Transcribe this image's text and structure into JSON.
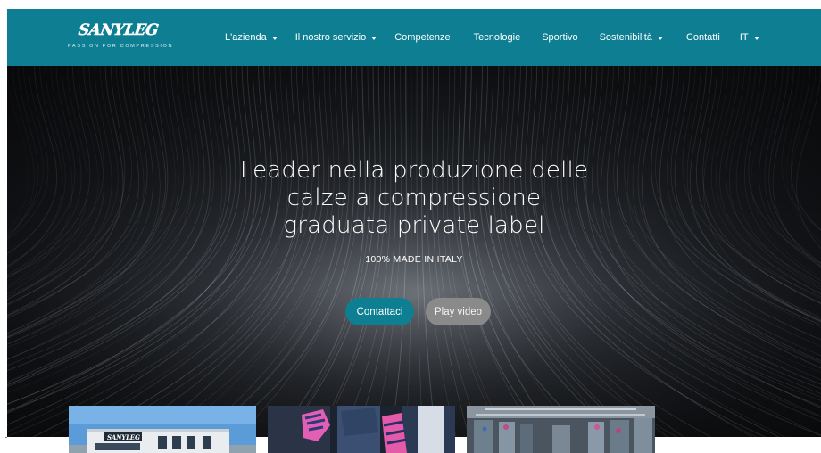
{
  "brand": {
    "logo_text": "SANYLEG",
    "tagline": "PASSION FOR COMPRESSION"
  },
  "nav": {
    "items": [
      {
        "label": "L'azienda",
        "dropdown": true
      },
      {
        "label": "Il nostro servizio",
        "dropdown": true
      },
      {
        "label": "Competenze",
        "dropdown": false
      },
      {
        "label": "Tecnologie",
        "dropdown": false
      },
      {
        "label": "Sportivo",
        "dropdown": false
      },
      {
        "label": "Sostenibilità",
        "dropdown": true
      },
      {
        "label": "Contatti",
        "dropdown": false
      },
      {
        "label": "IT",
        "dropdown": true
      }
    ]
  },
  "hero": {
    "title_lines": [
      "Leader nella produzione delle",
      "calze a compressione",
      "graduata private label"
    ],
    "subtitle": "100% MADE IN ITALY",
    "cta_primary": "Contattaci",
    "cta_secondary": "Play video"
  },
  "cards": [
    {
      "name": "building-photo",
      "sign_text": "SANYLEG"
    },
    {
      "name": "athlete-socks-photo"
    },
    {
      "name": "factory-machines-photo"
    }
  ],
  "colors": {
    "brand_teal": "#0e7f92",
    "button_secondary": "#8a8a8a",
    "hero_dark": "#111316"
  }
}
